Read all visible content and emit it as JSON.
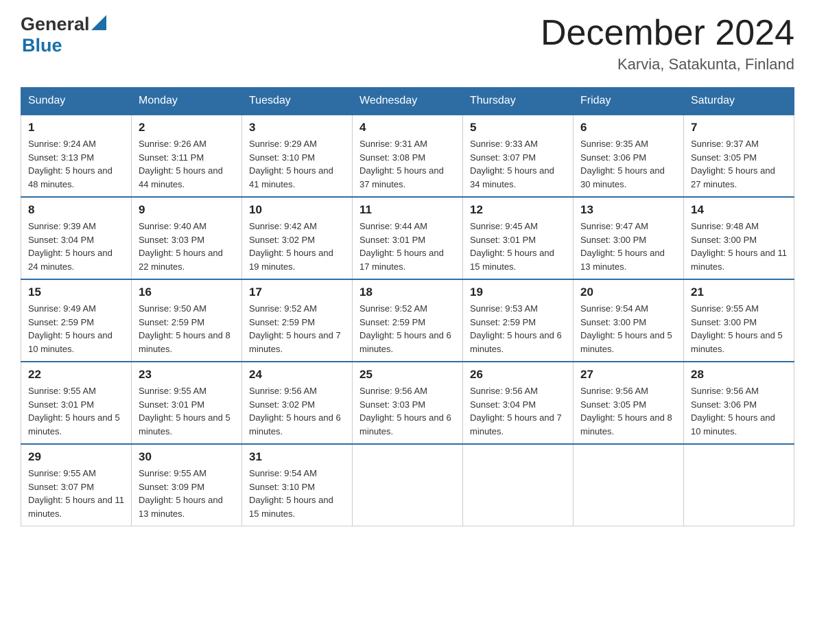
{
  "header": {
    "logo": {
      "text_general": "General",
      "text_blue": "Blue",
      "aria": "GeneralBlue logo"
    },
    "title": "December 2024",
    "location": "Karvia, Satakunta, Finland"
  },
  "columns": [
    "Sunday",
    "Monday",
    "Tuesday",
    "Wednesday",
    "Thursday",
    "Friday",
    "Saturday"
  ],
  "weeks": [
    [
      {
        "day": "1",
        "sunrise": "9:24 AM",
        "sunset": "3:13 PM",
        "daylight": "5 hours and 48 minutes."
      },
      {
        "day": "2",
        "sunrise": "9:26 AM",
        "sunset": "3:11 PM",
        "daylight": "5 hours and 44 minutes."
      },
      {
        "day": "3",
        "sunrise": "9:29 AM",
        "sunset": "3:10 PM",
        "daylight": "5 hours and 41 minutes."
      },
      {
        "day": "4",
        "sunrise": "9:31 AM",
        "sunset": "3:08 PM",
        "daylight": "5 hours and 37 minutes."
      },
      {
        "day": "5",
        "sunrise": "9:33 AM",
        "sunset": "3:07 PM",
        "daylight": "5 hours and 34 minutes."
      },
      {
        "day": "6",
        "sunrise": "9:35 AM",
        "sunset": "3:06 PM",
        "daylight": "5 hours and 30 minutes."
      },
      {
        "day": "7",
        "sunrise": "9:37 AM",
        "sunset": "3:05 PM",
        "daylight": "5 hours and 27 minutes."
      }
    ],
    [
      {
        "day": "8",
        "sunrise": "9:39 AM",
        "sunset": "3:04 PM",
        "daylight": "5 hours and 24 minutes."
      },
      {
        "day": "9",
        "sunrise": "9:40 AM",
        "sunset": "3:03 PM",
        "daylight": "5 hours and 22 minutes."
      },
      {
        "day": "10",
        "sunrise": "9:42 AM",
        "sunset": "3:02 PM",
        "daylight": "5 hours and 19 minutes."
      },
      {
        "day": "11",
        "sunrise": "9:44 AM",
        "sunset": "3:01 PM",
        "daylight": "5 hours and 17 minutes."
      },
      {
        "day": "12",
        "sunrise": "9:45 AM",
        "sunset": "3:01 PM",
        "daylight": "5 hours and 15 minutes."
      },
      {
        "day": "13",
        "sunrise": "9:47 AM",
        "sunset": "3:00 PM",
        "daylight": "5 hours and 13 minutes."
      },
      {
        "day": "14",
        "sunrise": "9:48 AM",
        "sunset": "3:00 PM",
        "daylight": "5 hours and 11 minutes."
      }
    ],
    [
      {
        "day": "15",
        "sunrise": "9:49 AM",
        "sunset": "2:59 PM",
        "daylight": "5 hours and 10 minutes."
      },
      {
        "day": "16",
        "sunrise": "9:50 AM",
        "sunset": "2:59 PM",
        "daylight": "5 hours and 8 minutes."
      },
      {
        "day": "17",
        "sunrise": "9:52 AM",
        "sunset": "2:59 PM",
        "daylight": "5 hours and 7 minutes."
      },
      {
        "day": "18",
        "sunrise": "9:52 AM",
        "sunset": "2:59 PM",
        "daylight": "5 hours and 6 minutes."
      },
      {
        "day": "19",
        "sunrise": "9:53 AM",
        "sunset": "2:59 PM",
        "daylight": "5 hours and 6 minutes."
      },
      {
        "day": "20",
        "sunrise": "9:54 AM",
        "sunset": "3:00 PM",
        "daylight": "5 hours and 5 minutes."
      },
      {
        "day": "21",
        "sunrise": "9:55 AM",
        "sunset": "3:00 PM",
        "daylight": "5 hours and 5 minutes."
      }
    ],
    [
      {
        "day": "22",
        "sunrise": "9:55 AM",
        "sunset": "3:01 PM",
        "daylight": "5 hours and 5 minutes."
      },
      {
        "day": "23",
        "sunrise": "9:55 AM",
        "sunset": "3:01 PM",
        "daylight": "5 hours and 5 minutes."
      },
      {
        "day": "24",
        "sunrise": "9:56 AM",
        "sunset": "3:02 PM",
        "daylight": "5 hours and 6 minutes."
      },
      {
        "day": "25",
        "sunrise": "9:56 AM",
        "sunset": "3:03 PM",
        "daylight": "5 hours and 6 minutes."
      },
      {
        "day": "26",
        "sunrise": "9:56 AM",
        "sunset": "3:04 PM",
        "daylight": "5 hours and 7 minutes."
      },
      {
        "day": "27",
        "sunrise": "9:56 AM",
        "sunset": "3:05 PM",
        "daylight": "5 hours and 8 minutes."
      },
      {
        "day": "28",
        "sunrise": "9:56 AM",
        "sunset": "3:06 PM",
        "daylight": "5 hours and 10 minutes."
      }
    ],
    [
      {
        "day": "29",
        "sunrise": "9:55 AM",
        "sunset": "3:07 PM",
        "daylight": "5 hours and 11 minutes."
      },
      {
        "day": "30",
        "sunrise": "9:55 AM",
        "sunset": "3:09 PM",
        "daylight": "5 hours and 13 minutes."
      },
      {
        "day": "31",
        "sunrise": "9:54 AM",
        "sunset": "3:10 PM",
        "daylight": "5 hours and 15 minutes."
      },
      null,
      null,
      null,
      null
    ]
  ]
}
